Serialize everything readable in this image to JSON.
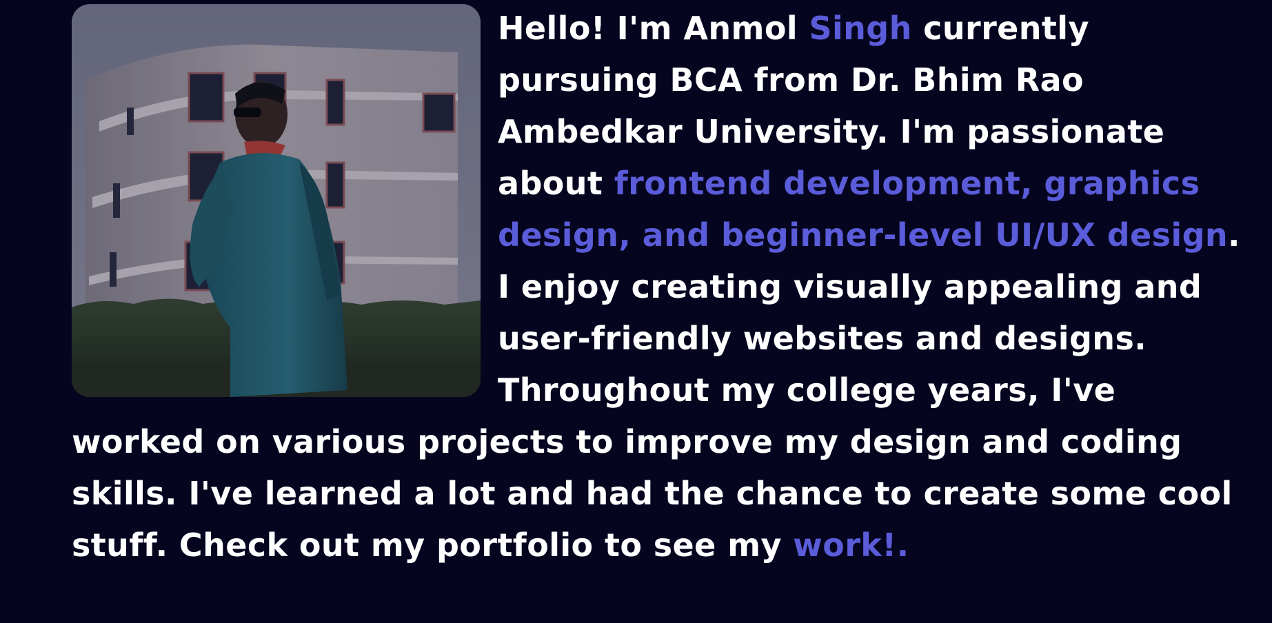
{
  "about": {
    "photo_alt": "Portrait photo of Anmol Singh in front of a university building",
    "segments": [
      {
        "text": "Hello! I'm Anmol ",
        "highlight": false
      },
      {
        "text": "Singh",
        "highlight": true
      },
      {
        "text": " currently pursuing BCA from Dr. Bhim Rao Ambedkar University. I'm passionate about ",
        "highlight": false
      },
      {
        "text": "frontend development, graphics design, and beginner-level UI/UX design",
        "highlight": true
      },
      {
        "text": ". I enjoy creating visually appealing and user-friendly websites and designs. Throughout my college years, I've worked on various projects to improve my design and coding skills. I've learned a lot and had the chance to create some cool stuff. Check out my portfolio to see my ",
        "highlight": false
      },
      {
        "text": "work!.",
        "highlight": true
      }
    ]
  },
  "colors": {
    "background": "#06051f",
    "text": "#ffffff",
    "accent": "#5a5cd9"
  }
}
